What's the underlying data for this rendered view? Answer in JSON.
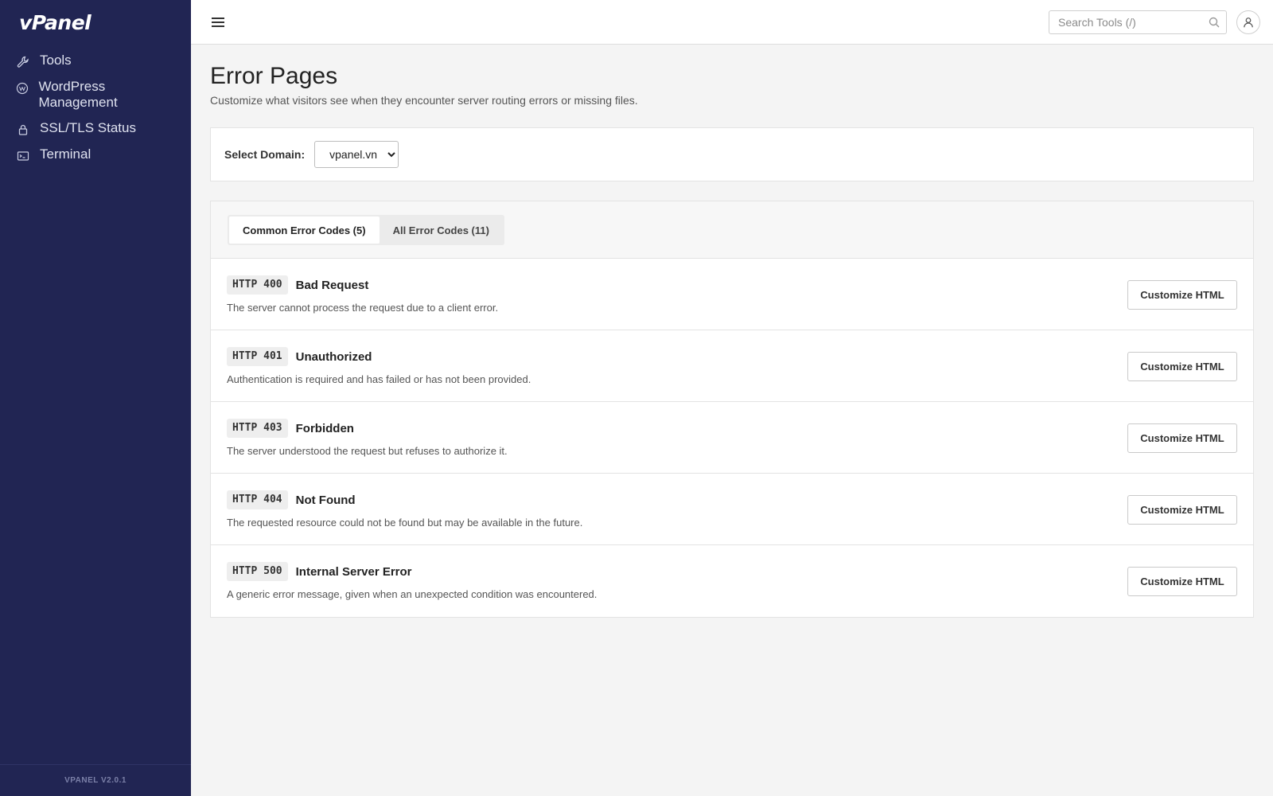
{
  "app": {
    "brand": "vPanel",
    "version": "VPANEL V2.0.1"
  },
  "sidebar": {
    "items": [
      {
        "label": "Tools",
        "icon": "wrench-icon"
      },
      {
        "label": "WordPress Management",
        "icon": "wordpress-icon"
      },
      {
        "label": "SSL/TLS Status",
        "icon": "lock-icon"
      },
      {
        "label": "Terminal",
        "icon": "terminal-icon"
      }
    ]
  },
  "topbar": {
    "search_placeholder": "Search Tools (/)"
  },
  "page": {
    "title": "Error Pages",
    "subtitle": "Customize what visitors see when they encounter server routing errors or missing files."
  },
  "domain": {
    "label": "Select Domain:",
    "selected": "vpanel.vn"
  },
  "tabs": [
    {
      "label": "Common Error Codes (5)",
      "active": true
    },
    {
      "label": "All Error Codes (11)",
      "active": false
    }
  ],
  "errors": [
    {
      "code": "HTTP 400",
      "name": "Bad Request",
      "description": "The server cannot process the request due to a client error.",
      "button": "Customize HTML"
    },
    {
      "code": "HTTP 401",
      "name": "Unauthorized",
      "description": "Authentication is required and has failed or has not been provided.",
      "button": "Customize HTML"
    },
    {
      "code": "HTTP 403",
      "name": "Forbidden",
      "description": "The server understood the request but refuses to authorize it.",
      "button": "Customize HTML"
    },
    {
      "code": "HTTP 404",
      "name": "Not Found",
      "description": "The requested resource could not be found but may be available in the future.",
      "button": "Customize HTML"
    },
    {
      "code": "HTTP 500",
      "name": "Internal Server Error",
      "description": "A generic error message, given when an unexpected condition was encountered.",
      "button": "Customize HTML"
    }
  ],
  "colors": {
    "sidebar_bg": "#212553",
    "page_bg": "#f4f4f4",
    "card_bg": "#ffffff"
  }
}
